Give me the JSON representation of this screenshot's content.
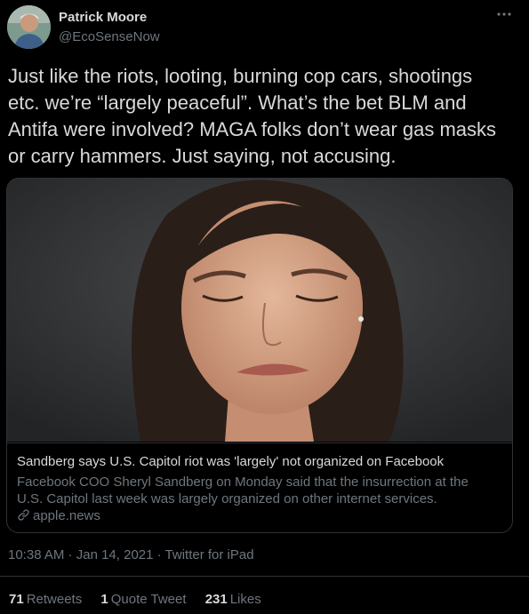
{
  "author": {
    "name": "Patrick Moore",
    "handle": "@EcoSenseNow"
  },
  "tweet": {
    "text": "Just like the riots, looting, burning cop cars, shootings\netc. we’re “largely peaceful”. What’s the bet BLM and\nAntifa were involved? MAGA folks don’t wear gas masks\nor carry hammers. Just saying, not accusing.",
    "time": "10:38 AM",
    "separator1": " · ",
    "date": "Jan 14, 2021",
    "separator2": " · ",
    "source": "Twitter for iPad"
  },
  "card": {
    "title": "Sandberg says U.S. Capitol riot was 'largely' not organized on Facebook",
    "description": "Facebook COO Sheryl Sandberg on Monday said that the insurrection at the U.S. Capitol last week was largely organized on other internet services.",
    "domain": "apple.news",
    "link_icon": "link-icon"
  },
  "stats": {
    "retweets_count": "71",
    "retweets_label": "Retweets",
    "quotes_count": "1",
    "quotes_label": "Quote Tweet",
    "likes_count": "231",
    "likes_label": "Likes"
  },
  "colors": {
    "background": "#000000",
    "primary_text": "#d9d9d9",
    "secondary_text": "#6e767d",
    "border": "#2f3336"
  }
}
